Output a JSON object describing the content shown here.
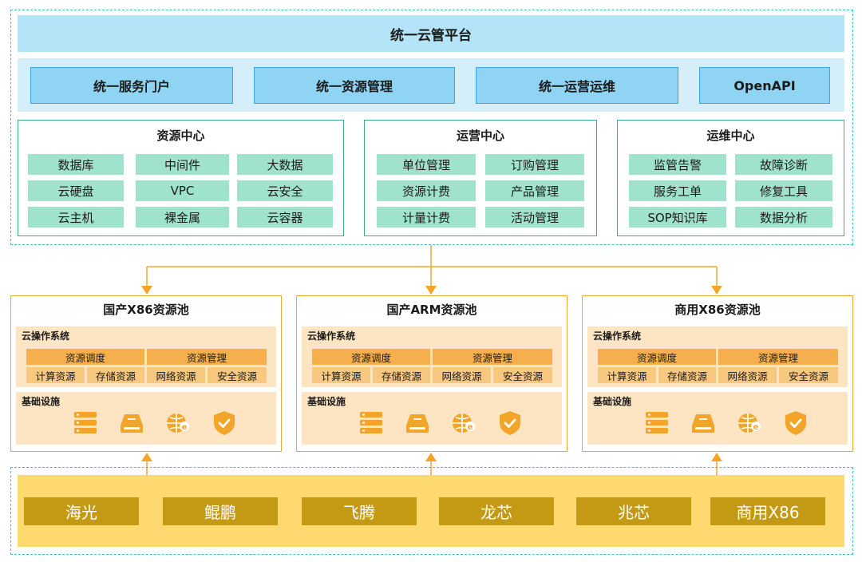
{
  "platform": {
    "title": "统一云管平台"
  },
  "portal_items": [
    "统一服务门户",
    "统一资源管理",
    "统一运营运维",
    "OpenAPI"
  ],
  "centers": [
    {
      "title": "资源中心",
      "items": [
        "数据库",
        "中间件",
        "大数据",
        "云硬盘",
        "VPC",
        "云安全",
        "云主机",
        "裸金属",
        "云容器"
      ]
    },
    {
      "title": "运营中心",
      "items": [
        "单位管理",
        "订购管理",
        "资源计费",
        "产品管理",
        "计量计费",
        "活动管理"
      ]
    },
    {
      "title": "运维中心",
      "items": [
        "监管告警",
        "故障诊断",
        "服务工单",
        "修复工具",
        "SOP知识库",
        "数据分析"
      ]
    }
  ],
  "pools": [
    {
      "title": "国产X86资源池"
    },
    {
      "title": "国产ARM资源池"
    },
    {
      "title": "商用X86资源池"
    }
  ],
  "pool_common": {
    "os_label": "云操作系统",
    "sched_items": [
      "资源调度",
      "资源管理"
    ],
    "resource_items": [
      "计算资源",
      "存储资源",
      "网络资源",
      "安全资源"
    ],
    "infra_label": "基础设施",
    "infra_icons": [
      "server-rack-icon",
      "storage-drive-icon",
      "network-globe-icon",
      "security-shield-icon"
    ]
  },
  "chips": [
    "海光",
    "鲲鹏",
    "飞腾",
    "龙芯",
    "兆芯",
    "商用X86"
  ],
  "colors": {
    "dashed_frame": "#3cc4c0",
    "title_bar": "#b3e4f7",
    "portal_button": "#8fd4f2",
    "center_chip": "#9fe3cd",
    "pool_border": "#f0a830",
    "pool_panel": "#fde5c4",
    "sched_chip": "#f5b04d",
    "icon_orange": "#f3a52a",
    "gold_band": "#fdd970",
    "brand_chip": "#c49a14"
  }
}
